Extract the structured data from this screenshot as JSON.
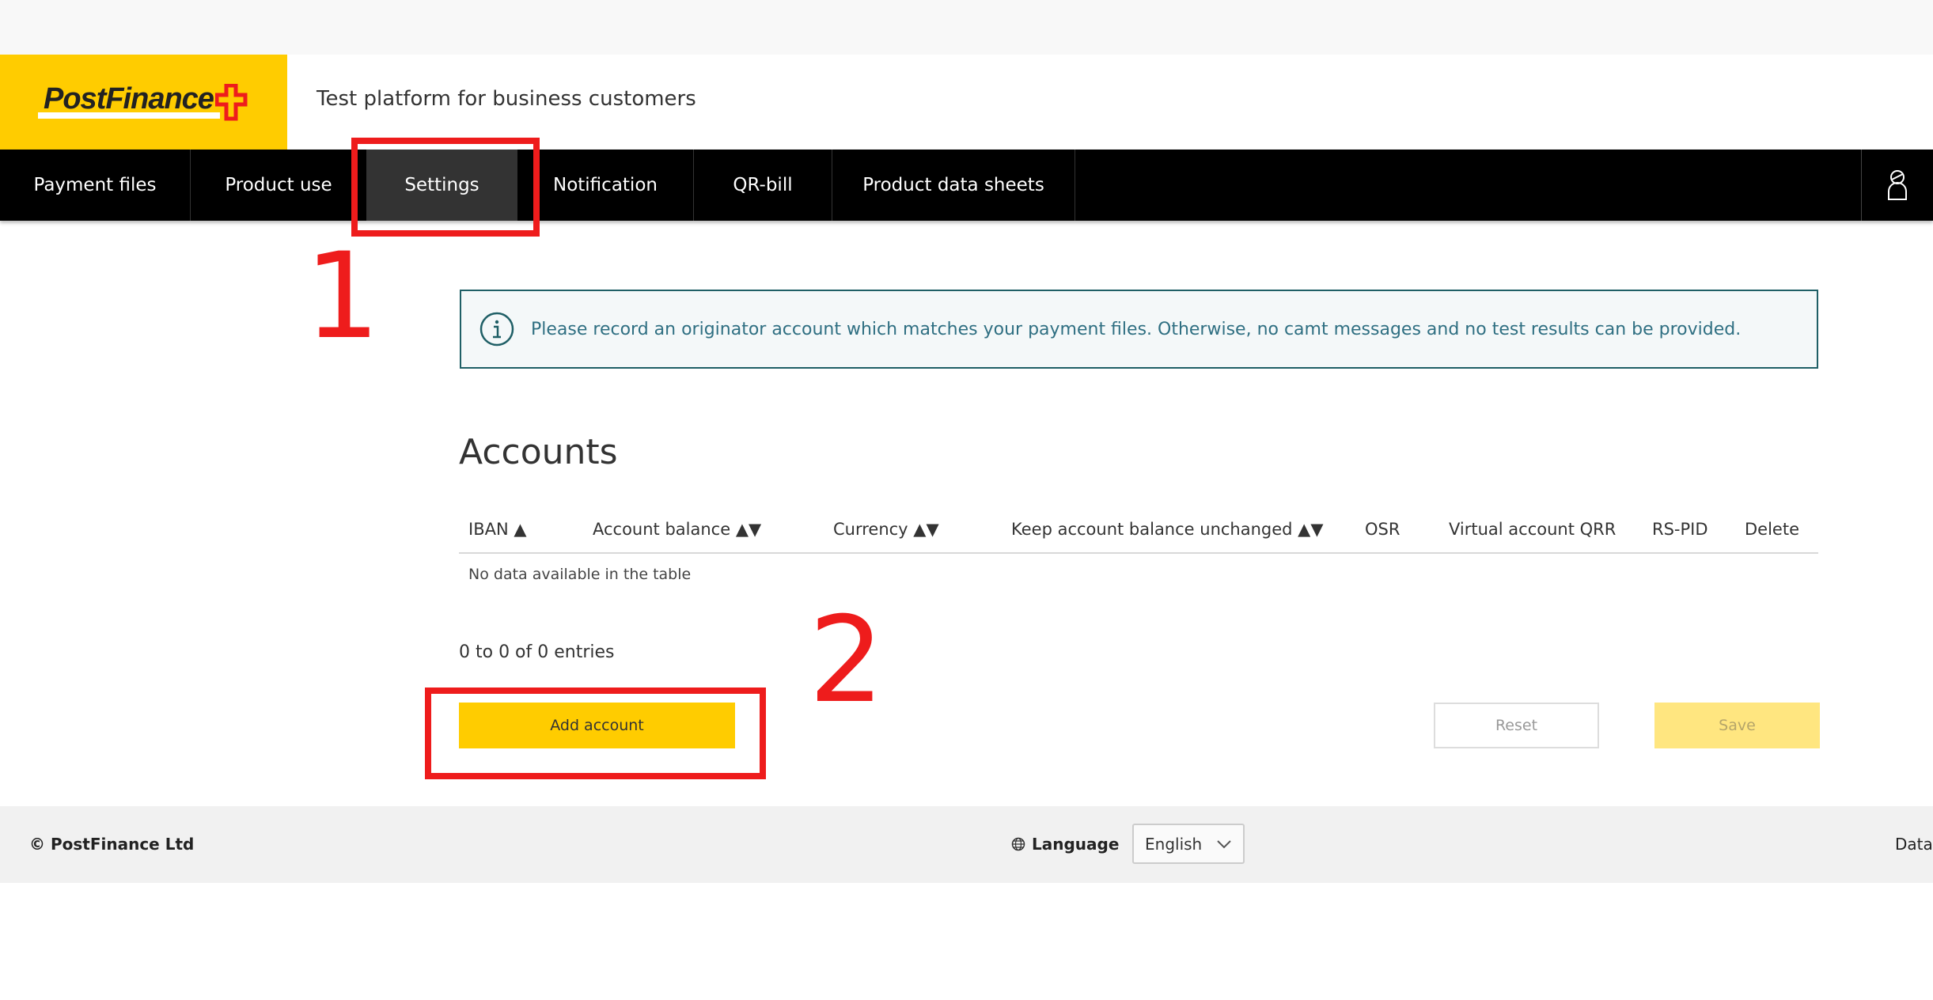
{
  "brand": {
    "logo": "PostFinance",
    "subtitle": "Test platform for business customers",
    "yellow": "#ffcc00",
    "red": "#ee1c1c"
  },
  "nav": {
    "items": [
      {
        "label": "Payment files"
      },
      {
        "label": "Product use"
      },
      {
        "label": "Settings",
        "active": true
      },
      {
        "label": "Notification"
      },
      {
        "label": "QR-bill"
      },
      {
        "label": "Product data sheets"
      }
    ],
    "user_icon": "user-icon"
  },
  "annotations": {
    "step1": "1",
    "step2": "2"
  },
  "info": {
    "icon": "info-icon",
    "text": "Please record an originator account which matches your payment files. Otherwise, no camt messages and no test results can be provided."
  },
  "accounts": {
    "title": "Accounts",
    "columns": [
      "IBAN ▲",
      "Account balance ▲▼",
      "Currency ▲▼",
      "Keep account balance unchanged ▲▼",
      "OSR",
      "Virtual account QRR",
      "RS-PID",
      "Delete"
    ],
    "empty": "No data available in the table",
    "entries": "0 to 0 of 0 entries",
    "add": "Add account",
    "reset": "Reset",
    "save": "Save"
  },
  "footer": {
    "copyright": "© PostFinance Ltd",
    "language_label": "Language",
    "language_value": "English",
    "data_link": "Data"
  }
}
